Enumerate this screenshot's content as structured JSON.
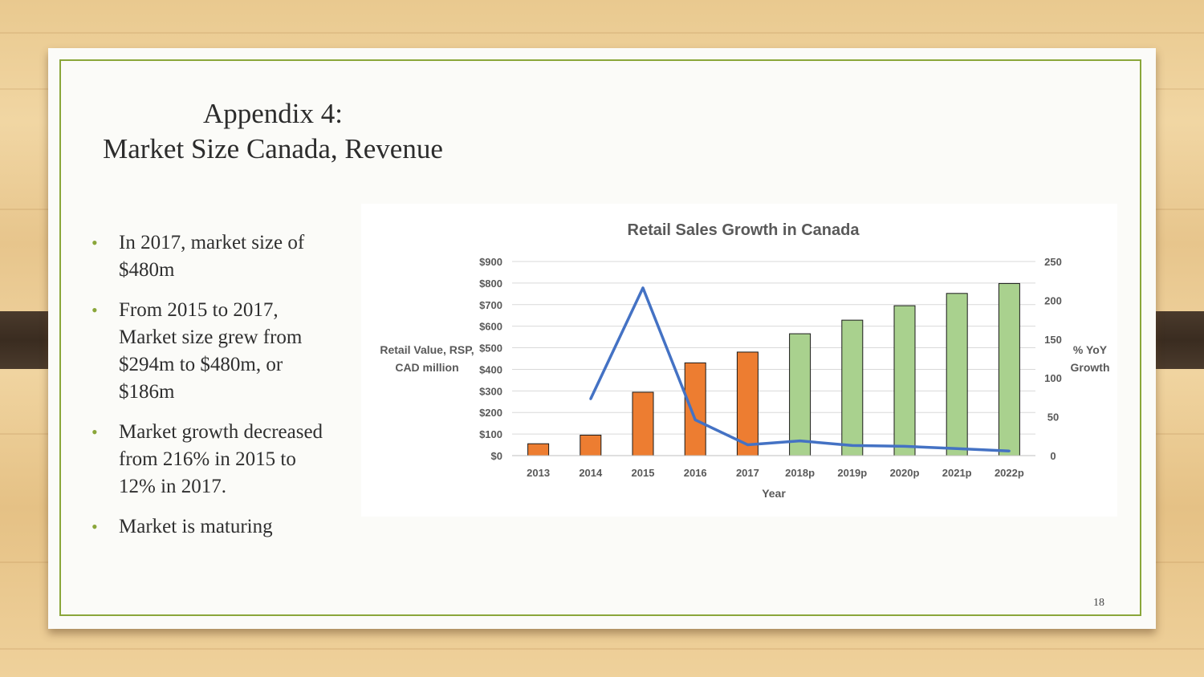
{
  "slide": {
    "title_line1": "Appendix 4:",
    "title_line2": "Market Size Canada, Revenue",
    "bullets": [
      "In 2017, market size of $480m",
      "From 2015 to 2017, Market size grew from $294m to $480m, or $186m",
      "Market growth decreased from 216% in 2015 to 12% in 2017.",
      "Market is maturing"
    ],
    "page_number": "18"
  },
  "chart_data": {
    "type": "bar",
    "title": "Retail Sales Growth in Canada",
    "xlabel": "Year",
    "ylabel_line1": "Retail Value, RSP,",
    "ylabel_line2": "CAD million",
    "y2label_line1": "% YoY",
    "y2label_line2": "Growth",
    "categories": [
      "2013",
      "2014",
      "2015",
      "2016",
      "2017",
      "2018p",
      "2019p",
      "2020p",
      "2021p",
      "2022p"
    ],
    "series": [
      {
        "kind": "bar",
        "values": [
          55,
          95,
          294,
          430,
          480,
          565,
          628,
          695,
          752,
          798
        ],
        "colors": [
          "#ed7d31",
          "#ed7d31",
          "#ed7d31",
          "#ed7d31",
          "#ed7d31",
          "#a9d18e",
          "#a9d18e",
          "#a9d18e",
          "#a9d18e",
          "#a9d18e"
        ]
      },
      {
        "kind": "line",
        "axis": "secondary",
        "values": [
          null,
          73,
          216,
          46,
          14,
          19,
          13,
          12,
          9,
          6
        ],
        "color": "#4472c4"
      }
    ],
    "ylim": [
      0,
      900
    ],
    "y_ticks": [
      "$0",
      "$100",
      "$200",
      "$300",
      "$400",
      "$500",
      "$600",
      "$700",
      "$800",
      "$900"
    ],
    "y2lim": [
      0,
      250
    ],
    "y2_ticks": [
      "0",
      "50",
      "100",
      "150",
      "200",
      "250"
    ],
    "grid": true
  }
}
